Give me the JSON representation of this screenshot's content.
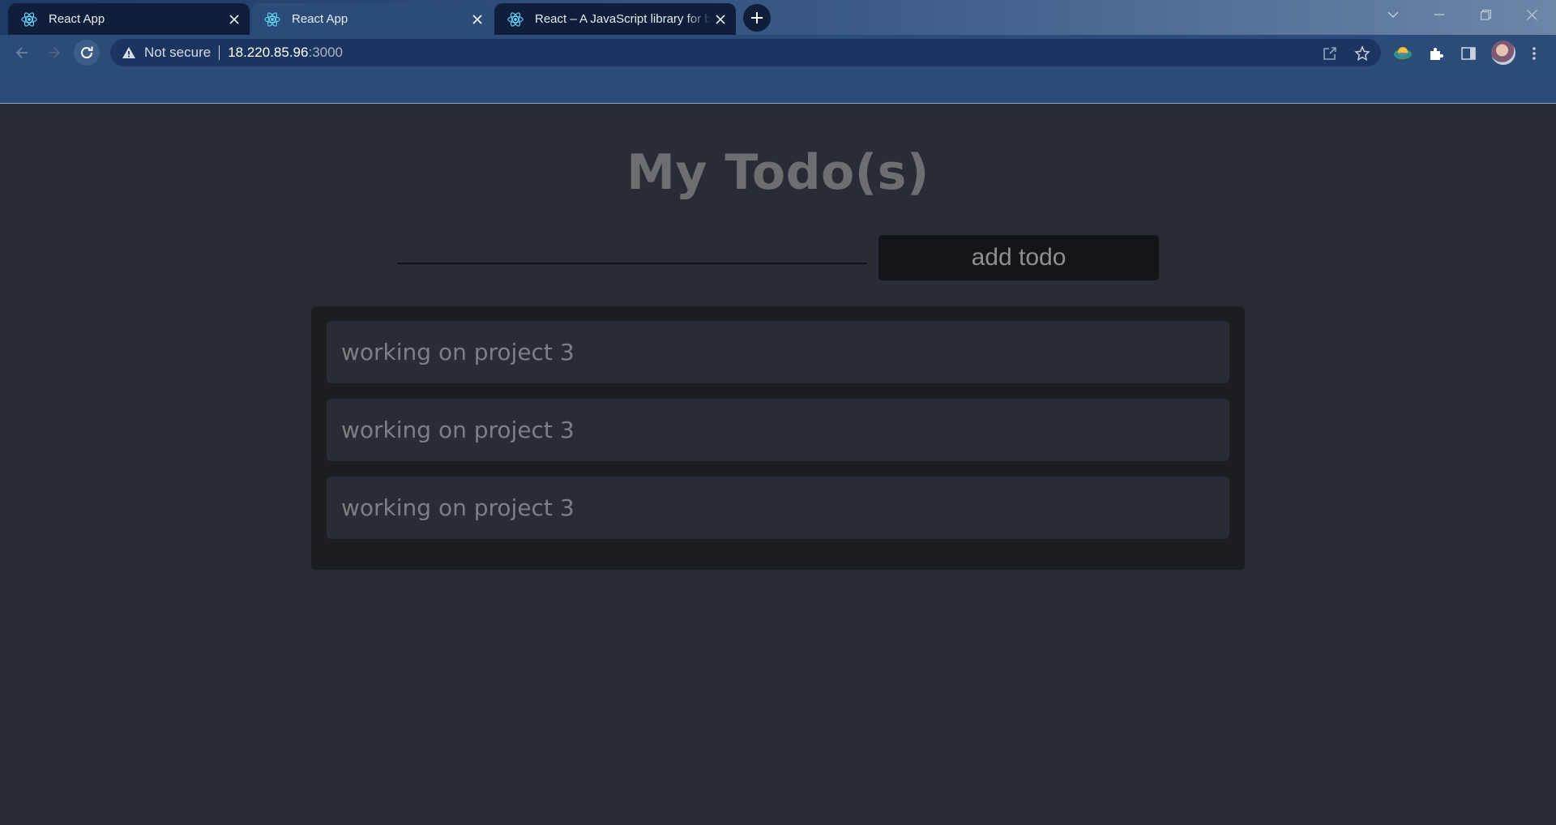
{
  "browser": {
    "tabs": [
      {
        "title": "React App",
        "active": false
      },
      {
        "title": "React App",
        "active": true
      },
      {
        "title": "React – A JavaScript library for bu",
        "active": false
      }
    ],
    "address": {
      "security_label": "Not secure",
      "host": "18.220.85.96",
      "port": ":3000"
    }
  },
  "app": {
    "title": "My Todo(s)",
    "input_value": "",
    "add_button_label": "add todo",
    "todos": [
      {
        "text": "working on project 3"
      },
      {
        "text": "working on project 3"
      },
      {
        "text": "working on project 3"
      }
    ]
  },
  "colors": {
    "page_background": "#282c34",
    "list_background": "#1b1d21",
    "browser_accent": "#2b4c78"
  }
}
